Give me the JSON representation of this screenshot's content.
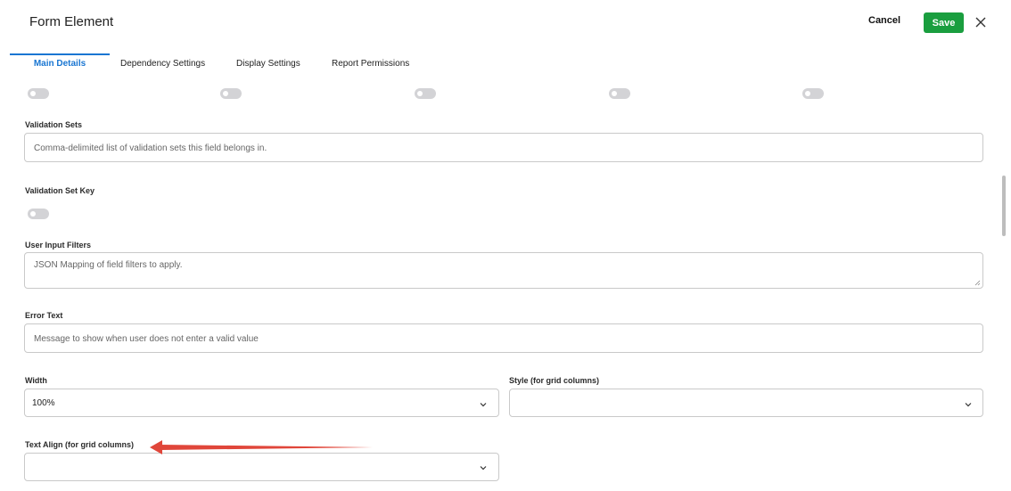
{
  "header": {
    "title": "Form Element",
    "cancel_label": "Cancel",
    "save_label": "Save",
    "accent_color": "#1a9e3f"
  },
  "tabs": [
    {
      "label": "Main Details",
      "active": true
    },
    {
      "label": "Dependency Settings",
      "active": false
    },
    {
      "label": "Display Settings",
      "active": false
    },
    {
      "label": "Report Permissions",
      "active": false
    }
  ],
  "toggles_row": [
    false,
    false,
    false,
    false,
    false
  ],
  "validation_sets": {
    "label": "Validation Sets",
    "placeholder": "Comma-delimited list of validation sets this field belongs in."
  },
  "validation_set_key": {
    "label": "Validation Set Key",
    "value": false
  },
  "user_input_filters": {
    "label": "User Input Filters",
    "placeholder": "JSON Mapping of field filters to apply."
  },
  "error_text": {
    "label": "Error Text",
    "placeholder": "Message to show when user does not enter a valid value"
  },
  "width": {
    "label": "Width",
    "value": "100%"
  },
  "style": {
    "label": "Style (for grid columns)",
    "value": ""
  },
  "text_align": {
    "label": "Text Align (for grid columns)",
    "value": ""
  },
  "annotation": {
    "arrow_color": "#e0463a"
  }
}
